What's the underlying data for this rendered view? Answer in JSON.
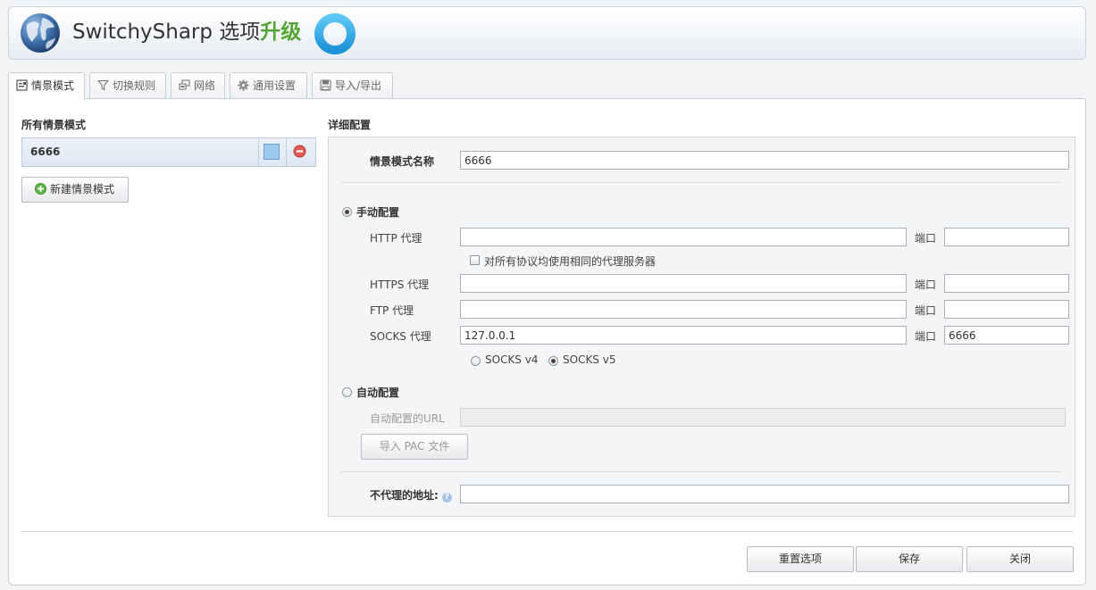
{
  "header": {
    "app_name": "SwitchySharp 选项",
    "upgrade_label": "升级",
    "globe_icon": "globe-icon",
    "ring_icon": "ring-icon"
  },
  "tabs": [
    {
      "label": "情景模式",
      "icon": "profile-icon",
      "active": true
    },
    {
      "label": "切换规则",
      "icon": "filter-icon",
      "active": false
    },
    {
      "label": "网络",
      "icon": "network-icon",
      "active": false
    },
    {
      "label": "通用设置",
      "icon": "gear-icon",
      "active": false
    },
    {
      "label": "导入/导出",
      "icon": "save-icon",
      "active": false
    }
  ],
  "profiles": {
    "title": "所有情景模式",
    "items": [
      {
        "name": "6666",
        "color": "#9dcaf0"
      }
    ],
    "new_button": "新建情景模式"
  },
  "detail": {
    "title": "详细配置",
    "profile_name_label": "情景模式名称",
    "profile_name_value": "6666",
    "manual": {
      "label": "手动配置",
      "selected": true,
      "http_label": "HTTP 代理",
      "http_value": "",
      "http_port": "",
      "same_proxy_label": "对所有协议均使用相同的代理服务器",
      "same_proxy_checked": false,
      "https_label": "HTTPS 代理",
      "https_value": "",
      "https_port": "",
      "ftp_label": "FTP 代理",
      "ftp_value": "",
      "ftp_port": "",
      "socks_label": "SOCKS 代理",
      "socks_value": "127.0.0.1",
      "socks_port": "6666",
      "port_label": "端口",
      "socks_v4_label": "SOCKS v4",
      "socks_v5_label": "SOCKS v5",
      "socks_version": "v5"
    },
    "auto": {
      "label": "自动配置",
      "selected": false,
      "url_label": "自动配置的URL",
      "url_value": "",
      "import_pac_button": "导入 PAC 文件"
    },
    "bypass_label": "不代理的地址:",
    "bypass_value": "",
    "help_icon": "?"
  },
  "footer": {
    "reset_button": "重置选项",
    "save_button": "保存",
    "close_button": "关闭"
  },
  "colors": {
    "accent_green": "#55a534",
    "ring_blue": "#2fa8e6",
    "delete_red": "#d9463e",
    "profile_bg": "#dce7f4"
  }
}
